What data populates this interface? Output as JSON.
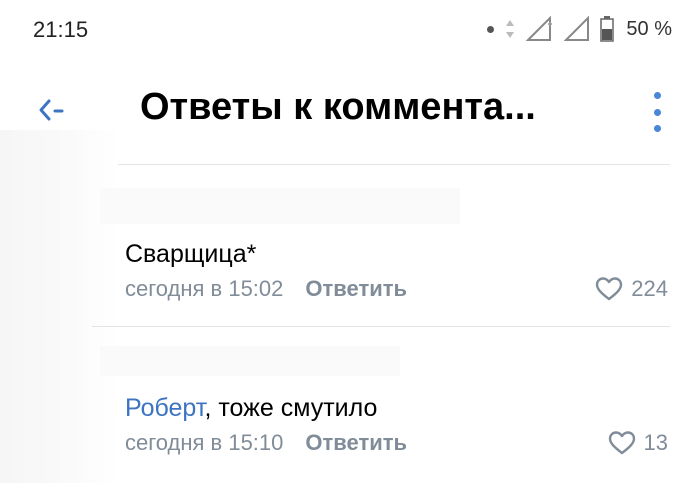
{
  "status_bar": {
    "time": "21:15",
    "battery": "50 %"
  },
  "header": {
    "title": "Ответы к коммента...",
    "back_icon": "back-arrow-icon",
    "menu_icon": "more-vertical-icon"
  },
  "comments": [
    {
      "author": "",
      "text": "Сварщица*",
      "time": "сегодня в 15:02",
      "reply_label": "Ответить",
      "likes": "224"
    },
    {
      "author": "Роберт",
      "text": ", тоже смутило",
      "time": "сегодня в 15:10",
      "reply_label": "Ответить",
      "likes": "13"
    }
  ],
  "colors": {
    "accent": "#3c74c2",
    "secondary_text": "#818c99",
    "divider": "#e3e4e8"
  }
}
